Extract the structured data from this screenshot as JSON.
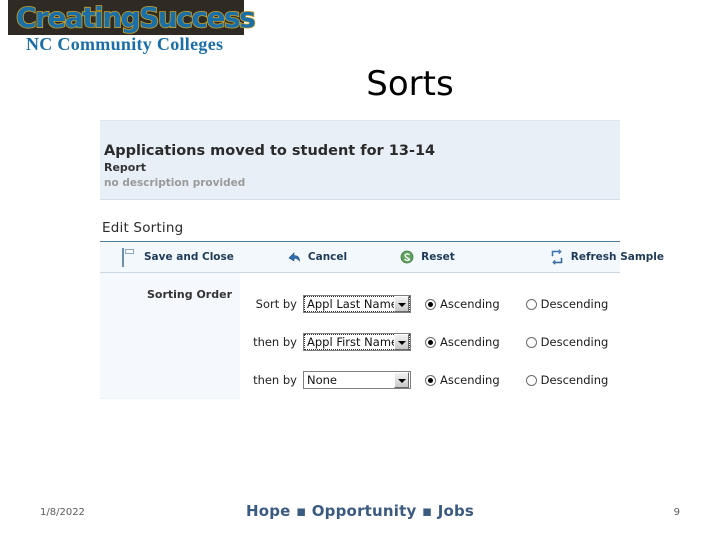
{
  "logo": {
    "word1": "Creating",
    "word2": "Success",
    "subtitle": "NC Community Colleges"
  },
  "slide": {
    "title": "Sorts"
  },
  "report_header": {
    "title": "Applications moved to student for 13-14",
    "type": "Report",
    "description": "no description provided"
  },
  "section": {
    "title": "Edit Sorting"
  },
  "toolbar": {
    "items": [
      {
        "label": "Save and Close",
        "icon": "save-icon"
      },
      {
        "label": "Cancel",
        "icon": "undo-arrow-icon"
      },
      {
        "label": "Reset",
        "icon": "reset-circular-icon"
      },
      {
        "label": "Refresh Sample",
        "icon": "refresh-icon"
      }
    ]
  },
  "sorting": {
    "group_label": "Sorting Order",
    "rows": [
      {
        "label": "Sort by",
        "value": "Appl Last Name",
        "focused": true,
        "ascending_label": "Ascending",
        "descending_label": "Descending",
        "direction": "ascending"
      },
      {
        "label": "then by",
        "value": "Appl First Name",
        "focused": true,
        "ascending_label": "Ascending",
        "descending_label": "Descending",
        "direction": "ascending"
      },
      {
        "label": "then by",
        "value": "None",
        "focused": false,
        "ascending_label": "Ascending",
        "descending_label": "Descending",
        "direction": "ascending"
      }
    ]
  },
  "footer": {
    "date": "1/8/2022",
    "tagline": "Hope ▪ Opportunity ▪ Jobs",
    "page": "9"
  },
  "colors": {
    "logo_blue": "#1a6fa8",
    "logo_gold": "#c9a227",
    "panel_blue": "#e9eff6",
    "toolbar_blue": "#f3f8fd",
    "toolbar_text": "#1f3a57",
    "footer_blue": "#3a5a80"
  }
}
